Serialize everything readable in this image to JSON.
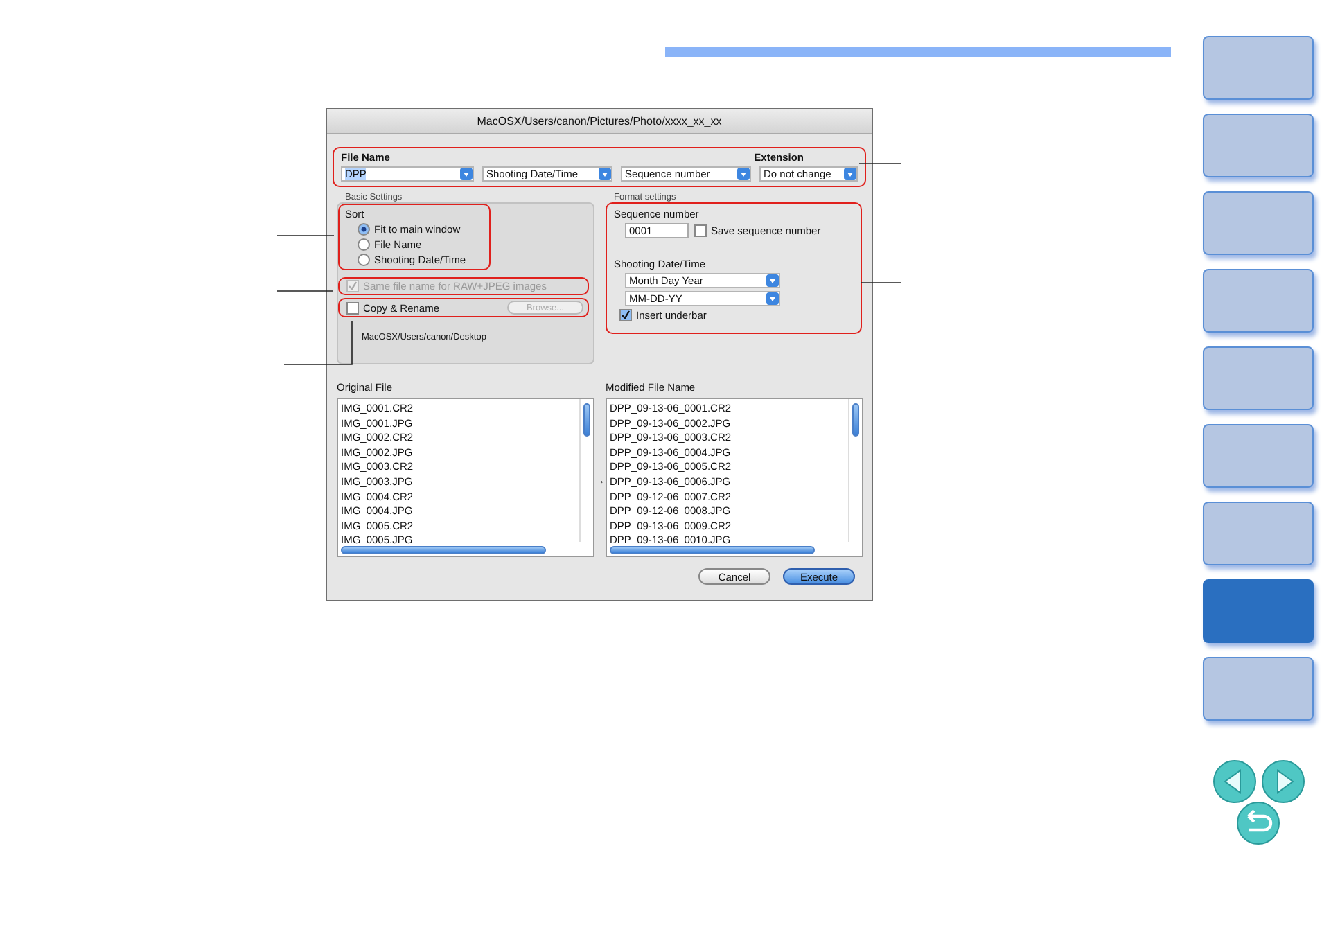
{
  "dialog": {
    "title": "MacOSX/Users/canon/Pictures/Photo/xxxx_xx_xx",
    "file_name": {
      "label": "File Name",
      "extension_label": "Extension",
      "fields": [
        {
          "kind": "combo",
          "value": "DPP"
        },
        {
          "kind": "select",
          "value": "Shooting Date/Time"
        },
        {
          "kind": "select",
          "value": "Sequence number"
        },
        {
          "kind": "select",
          "value": "Do not change"
        }
      ]
    },
    "basic_settings": {
      "title": "Basic Settings",
      "sort_label": "Sort",
      "sort_options": [
        {
          "label": "Fit to main window",
          "selected": true
        },
        {
          "label": "File Name",
          "selected": false
        },
        {
          "label": "Shooting Date/Time",
          "selected": false
        }
      ],
      "same_name": {
        "label": "Same file name for RAW+JPEG images",
        "checked": true,
        "disabled": true
      },
      "copy_rename": {
        "label": "Copy & Rename",
        "checked": false,
        "disabled": false
      },
      "browse_button": {
        "label": "Browse...",
        "disabled": true
      },
      "path": "MacOSX/Users/canon/Desktop"
    },
    "format_settings": {
      "title": "Format settings",
      "sequence_label": "Sequence number",
      "sequence_value": "0001",
      "save_sequence": {
        "label": "Save sequence number",
        "checked": false
      },
      "date_label": "Shooting Date/Time",
      "date_selects": [
        "Month Day Year",
        "MM-DD-YY"
      ],
      "insert_underbar": {
        "label": "Insert underbar",
        "checked": true
      }
    },
    "original_files": {
      "label": "Original File",
      "items": [
        {
          "name": "IMG_0001.CR2"
        },
        {
          "name": "IMG_0001.JPG"
        },
        {
          "name": "IMG_0002.CR2"
        },
        {
          "name": "IMG_0002.JPG"
        },
        {
          "name": "IMG_0003.CR2"
        },
        {
          "name": "IMG_0003.JPG"
        },
        {
          "name": "IMG_0004.CR2"
        },
        {
          "name": "IMG_0004.JPG"
        },
        {
          "name": "IMG_0005.CR2"
        },
        {
          "name": "IMG_0005.JPG"
        }
      ]
    },
    "modified_files": {
      "label": "Modified File Name",
      "marker": "→",
      "items": [
        {
          "name": "DPP_09-13-06_0001.CR2",
          "marked": false
        },
        {
          "name": "DPP_09-13-06_0002.JPG",
          "marked": false
        },
        {
          "name": "DPP_09-13-06_0003.CR2",
          "marked": false
        },
        {
          "name": "DPP_09-13-06_0004.JPG",
          "marked": false
        },
        {
          "name": "DPP_09-13-06_0005.CR2",
          "marked": false
        },
        {
          "name": "DPP_09-13-06_0006.JPG",
          "marked": true
        },
        {
          "name": "DPP_09-12-06_0007.CR2",
          "marked": false
        },
        {
          "name": "DPP_09-12-06_0008.JPG",
          "marked": false
        },
        {
          "name": "DPP_09-13-06_0009.CR2",
          "marked": false
        },
        {
          "name": "DPP_09-13-06_0010.JPG",
          "marked": false
        }
      ]
    },
    "buttons": [
      {
        "label": "Cancel",
        "default": false
      },
      {
        "label": "Execute",
        "default": true
      }
    ]
  },
  "sidebar": {
    "tabs": [
      {
        "selected": false
      },
      {
        "selected": false
      },
      {
        "selected": false
      },
      {
        "selected": false
      },
      {
        "selected": false
      },
      {
        "selected": false
      },
      {
        "selected": false
      },
      {
        "selected": true
      },
      {
        "selected": false
      }
    ]
  }
}
